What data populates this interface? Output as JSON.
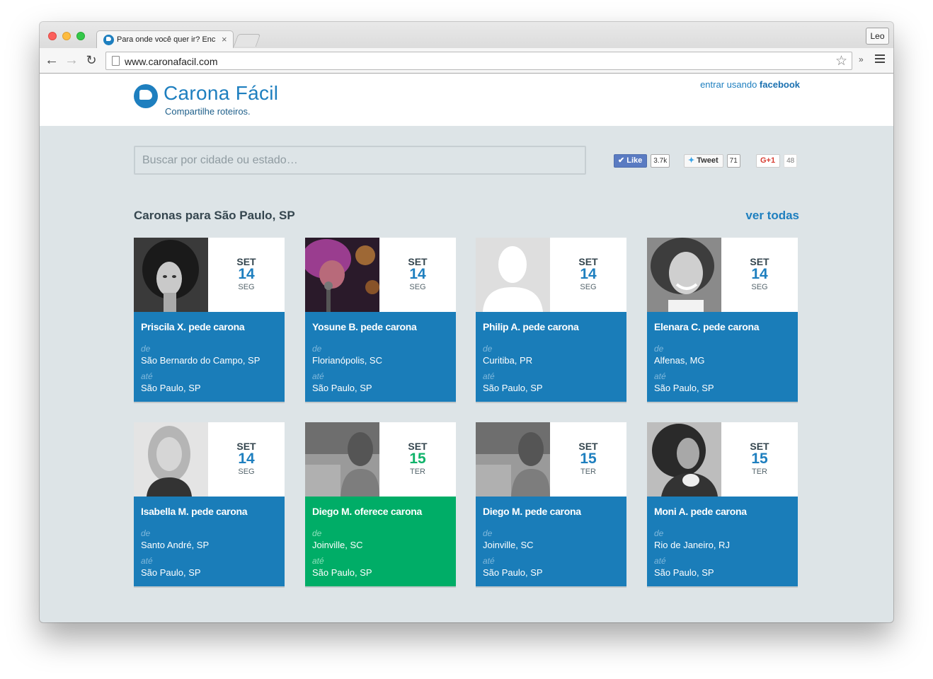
{
  "browser": {
    "tab_title": "Para onde você quer ir? Enc",
    "tab_close": "×",
    "user_label": "Leo",
    "url": "www.caronafacil.com",
    "back_icon": "←",
    "forward_icon": "→",
    "reload_icon": "↻",
    "star_icon": "☆",
    "extensions_chevron": "»"
  },
  "site": {
    "logo_text": "Carona Fácil",
    "tagline": "Compartilhe roteiros.",
    "login_prefix": "entrar usando ",
    "login_provider": "facebook"
  },
  "search": {
    "placeholder": "Buscar por cidade ou estado…"
  },
  "social": {
    "like_label": "Like",
    "like_count": "3.7k",
    "tweet_label": "Tweet",
    "tweet_count": "71",
    "gplus_label": "G+1",
    "gplus_count": "48"
  },
  "section": {
    "title": "Caronas para São Paulo, SP",
    "see_all": "ver todas"
  },
  "labels": {
    "from": "de",
    "to": "até"
  },
  "rides": [
    {
      "name": "Priscila X. pede carona",
      "month": "SET",
      "day": "14",
      "weekday": "SEG",
      "from": "São Bernardo do Campo, SP",
      "to": "São Paulo, SP",
      "type": "pede"
    },
    {
      "name": "Yosune B. pede carona",
      "month": "SET",
      "day": "14",
      "weekday": "SEG",
      "from": "Florianópolis, SC",
      "to": "São Paulo, SP",
      "type": "pede"
    },
    {
      "name": "Philip A. pede carona",
      "month": "SET",
      "day": "14",
      "weekday": "SEG",
      "from": "Curitiba, PR",
      "to": "São Paulo, SP",
      "type": "pede"
    },
    {
      "name": "Elenara C. pede carona",
      "month": "SET",
      "day": "14",
      "weekday": "SEG",
      "from": "Alfenas, MG",
      "to": "São Paulo, SP",
      "type": "pede"
    },
    {
      "name": "Isabella M. pede carona",
      "month": "SET",
      "day": "14",
      "weekday": "SEG",
      "from": "Santo André, SP",
      "to": "São Paulo, SP",
      "type": "pede"
    },
    {
      "name": "Diego M. oferece carona",
      "month": "SET",
      "day": "15",
      "weekday": "TER",
      "from": "Joinville, SC",
      "to": "São Paulo, SP",
      "type": "oferece"
    },
    {
      "name": "Diego M. pede carona",
      "month": "SET",
      "day": "15",
      "weekday": "TER",
      "from": "Joinville, SC",
      "to": "São Paulo, SP",
      "type": "pede"
    },
    {
      "name": "Moni A. pede carona",
      "month": "SET",
      "day": "15",
      "weekday": "TER",
      "from": "Rio de Janeiro, RJ",
      "to": "São Paulo, SP",
      "type": "pede"
    }
  ],
  "colors": {
    "brand_blue": "#1a7db9",
    "offer_green": "#00ad67",
    "page_bg": "#dde4e7"
  }
}
